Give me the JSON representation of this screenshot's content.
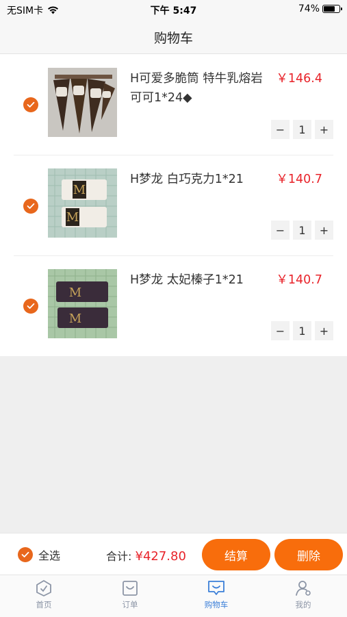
{
  "status_bar": {
    "carrier": "无SIM卡",
    "time": "下午 5:47",
    "battery": "74%",
    "battery_level": 0.74
  },
  "nav": {
    "title": "购物车"
  },
  "cart": {
    "items": [
      {
        "name": "H可爱多脆筒 特牛乳熔岩 可可1*24◆",
        "price": "￥146.4",
        "quantity": "1",
        "checked": true
      },
      {
        "name": "H梦龙 白巧克力1*21",
        "price": "￥140.7",
        "quantity": "1",
        "checked": true
      },
      {
        "name": "H梦龙 太妃榛子1*21",
        "price": "￥140.7",
        "quantity": "1",
        "checked": true
      }
    ]
  },
  "stepper": {
    "minus": "−",
    "plus": "+"
  },
  "footer": {
    "select_all": "全选",
    "total_label": "合计:",
    "total_amount": "¥427.80",
    "checkout": "结算",
    "delete": "删除"
  },
  "tabs": [
    {
      "label": "首页",
      "icon": "home-icon",
      "active": false
    },
    {
      "label": "订单",
      "icon": "order-icon",
      "active": false
    },
    {
      "label": "购物车",
      "icon": "cart-icon",
      "active": true
    },
    {
      "label": "我的",
      "icon": "profile-icon",
      "active": false
    }
  ],
  "colors": {
    "accent": "#f86d0c",
    "price": "#e8232a",
    "tab_active": "#3b7fd8",
    "tab_inactive": "#8c95a6"
  }
}
